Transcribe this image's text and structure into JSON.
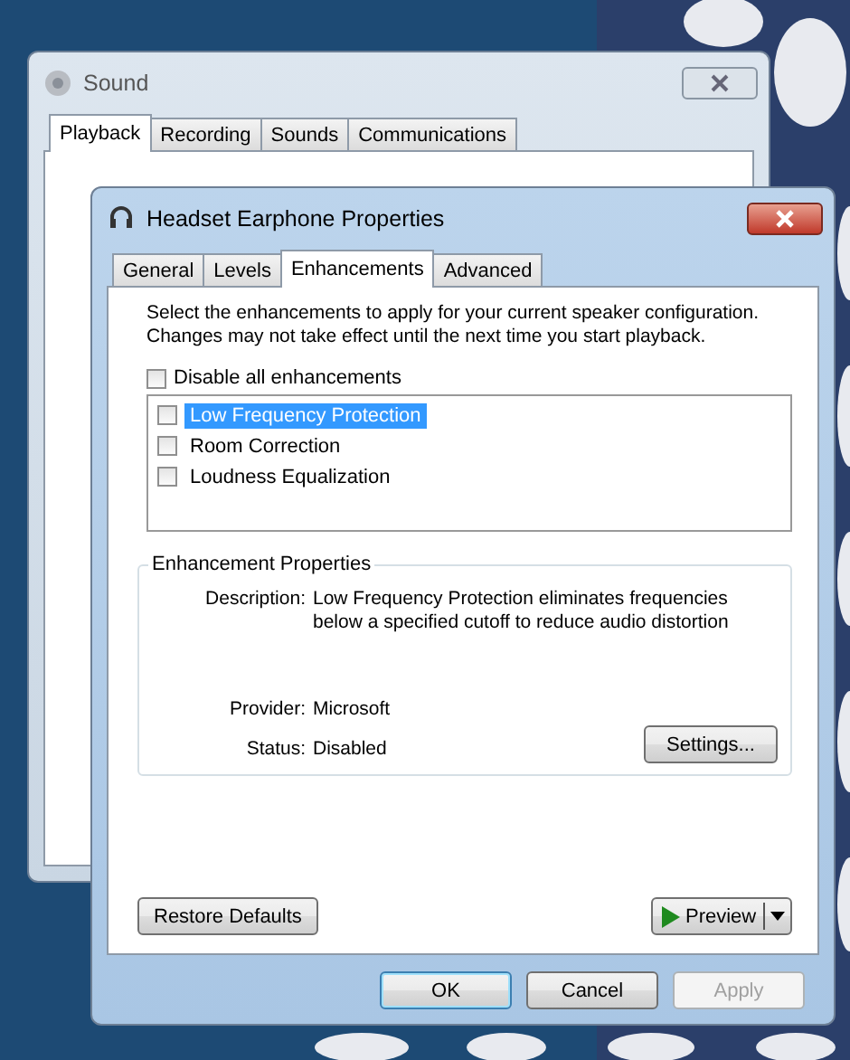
{
  "sound_window": {
    "title": "Sound",
    "tabs": [
      {
        "label": "Playback",
        "selected": true
      },
      {
        "label": "Recording",
        "selected": false
      },
      {
        "label": "Sounds",
        "selected": false
      },
      {
        "label": "Communications",
        "selected": false
      }
    ]
  },
  "dialog": {
    "title": "Headset Earphone Properties",
    "tabs": [
      {
        "label": "General",
        "selected": false
      },
      {
        "label": "Levels",
        "selected": false
      },
      {
        "label": "Enhancements",
        "selected": true
      },
      {
        "label": "Advanced",
        "selected": false
      }
    ],
    "intro": "Select the enhancements to apply for your current speaker configuration. Changes may not take effect until the next time you start playback.",
    "disable_all": {
      "label": "Disable all enhancements",
      "checked": false
    },
    "enhancements": [
      {
        "label": "Low Frequency Protection",
        "checked": false,
        "selected": true
      },
      {
        "label": "Room Correction",
        "checked": false,
        "selected": false
      },
      {
        "label": "Loudness Equalization",
        "checked": false,
        "selected": false
      }
    ],
    "properties": {
      "title": "Enhancement Properties",
      "fields": [
        {
          "label": "Description:",
          "value": "Low Frequency Protection eliminates frequencies below a specified cutoff to reduce audio distortion"
        },
        {
          "label": "Provider:",
          "value": "Microsoft"
        },
        {
          "label": "Status:",
          "value": "Disabled"
        }
      ],
      "settings_button": "Settings..."
    },
    "restore_button": "Restore Defaults",
    "preview_button": "Preview",
    "buttons": [
      {
        "label": "OK",
        "default": true,
        "disabled": false
      },
      {
        "label": "Cancel",
        "default": false,
        "disabled": false
      },
      {
        "label": "Apply",
        "default": false,
        "disabled": true
      }
    ]
  }
}
